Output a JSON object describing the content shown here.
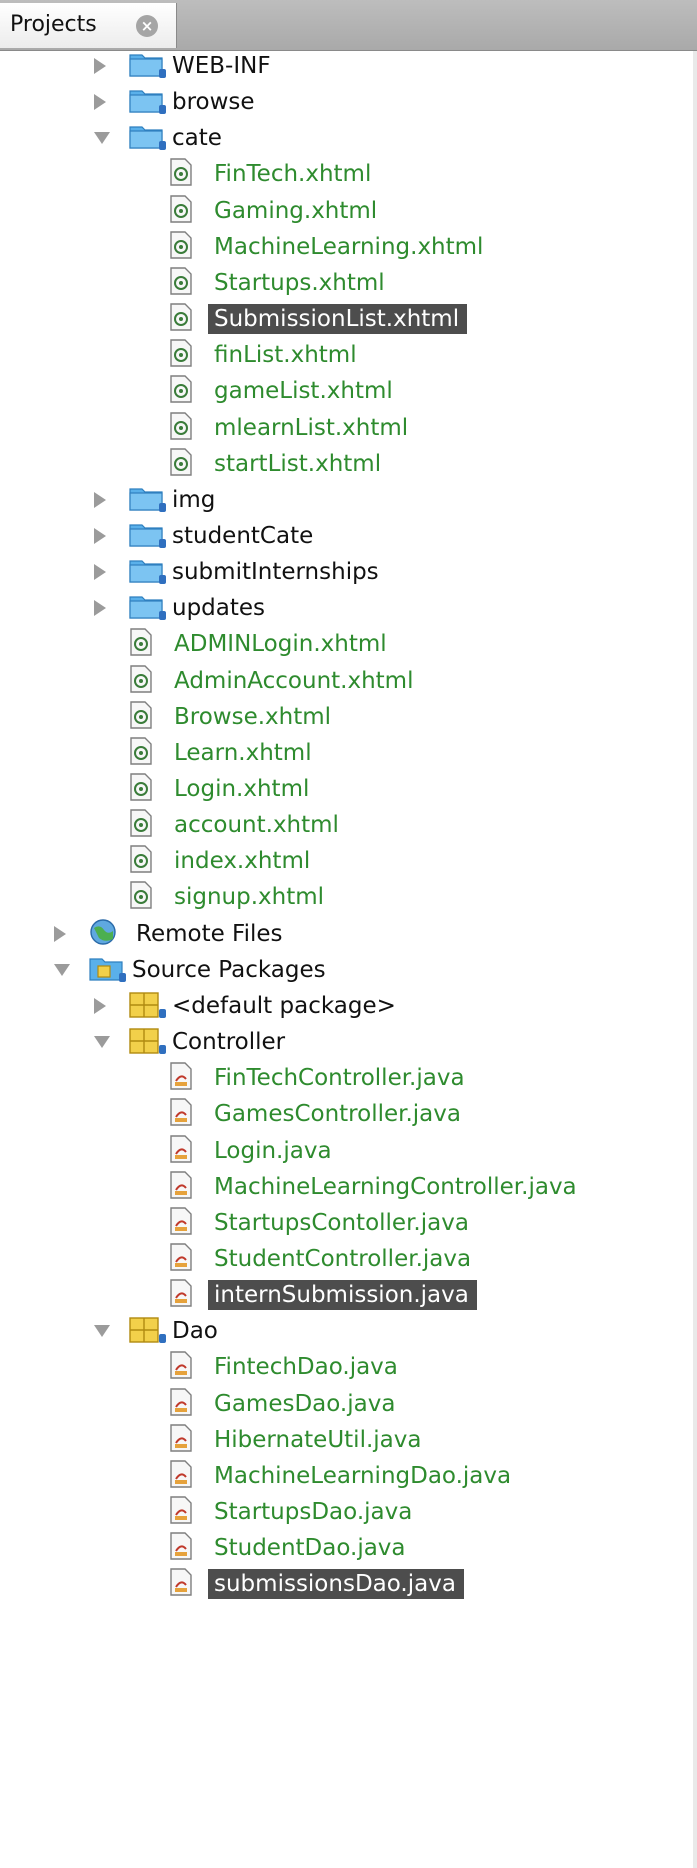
{
  "tab": {
    "label": "Projects"
  },
  "tree": [
    {
      "label": "WEB-INF",
      "kind": "folder",
      "depth": 2,
      "state": "collapsed",
      "style": "dark"
    },
    {
      "label": "browse",
      "kind": "folder",
      "depth": 2,
      "state": "collapsed",
      "style": "dark"
    },
    {
      "label": "cate",
      "kind": "folder",
      "depth": 2,
      "state": "expanded",
      "style": "dark"
    },
    {
      "label": "FinTech.xhtml",
      "kind": "xhtml",
      "depth": 3,
      "style": "green"
    },
    {
      "label": "Gaming.xhtml",
      "kind": "xhtml",
      "depth": 3,
      "style": "green"
    },
    {
      "label": "MachineLearning.xhtml",
      "kind": "xhtml",
      "depth": 3,
      "style": "green"
    },
    {
      "label": "Startups.xhtml",
      "kind": "xhtml",
      "depth": 3,
      "style": "green"
    },
    {
      "label": "SubmissionList.xhtml",
      "kind": "xhtml",
      "depth": 3,
      "style": "selected"
    },
    {
      "label": "finList.xhtml",
      "kind": "xhtml",
      "depth": 3,
      "style": "green"
    },
    {
      "label": "gameList.xhtml",
      "kind": "xhtml",
      "depth": 3,
      "style": "green"
    },
    {
      "label": "mlearnList.xhtml",
      "kind": "xhtml",
      "depth": 3,
      "style": "green"
    },
    {
      "label": "startList.xhtml",
      "kind": "xhtml",
      "depth": 3,
      "style": "green"
    },
    {
      "label": "img",
      "kind": "folder",
      "depth": 2,
      "state": "collapsed",
      "style": "dark"
    },
    {
      "label": "studentCate",
      "kind": "folder",
      "depth": 2,
      "state": "collapsed",
      "style": "dark"
    },
    {
      "label": "submitInternships",
      "kind": "folder",
      "depth": 2,
      "state": "collapsed",
      "style": "dark"
    },
    {
      "label": "updates",
      "kind": "folder",
      "depth": 2,
      "state": "collapsed",
      "style": "dark"
    },
    {
      "label": "ADMINLogin.xhtml",
      "kind": "xhtml",
      "depth": 2,
      "style": "green"
    },
    {
      "label": "AdminAccount.xhtml",
      "kind": "xhtml",
      "depth": 2,
      "style": "green"
    },
    {
      "label": "Browse.xhtml",
      "kind": "xhtml",
      "depth": 2,
      "style": "green"
    },
    {
      "label": "Learn.xhtml",
      "kind": "xhtml",
      "depth": 2,
      "style": "green"
    },
    {
      "label": "Login.xhtml",
      "kind": "xhtml",
      "depth": 2,
      "style": "green"
    },
    {
      "label": "account.xhtml",
      "kind": "xhtml",
      "depth": 2,
      "style": "green"
    },
    {
      "label": "index.xhtml",
      "kind": "xhtml",
      "depth": 2,
      "style": "green"
    },
    {
      "label": "signup.xhtml",
      "kind": "xhtml",
      "depth": 2,
      "style": "green"
    },
    {
      "label": "Remote Files",
      "kind": "globe",
      "depth": 1,
      "state": "collapsed",
      "style": "dark"
    },
    {
      "label": "Source Packages",
      "kind": "srcroot",
      "depth": 1,
      "state": "expanded",
      "style": "dark"
    },
    {
      "label": "<default package>",
      "kind": "package",
      "depth": 2,
      "state": "collapsed",
      "style": "dark"
    },
    {
      "label": "Controller",
      "kind": "package",
      "depth": 2,
      "state": "expanded",
      "style": "dark"
    },
    {
      "label": "FinTechController.java",
      "kind": "java",
      "depth": 3,
      "style": "green"
    },
    {
      "label": "GamesController.java",
      "kind": "java",
      "depth": 3,
      "style": "green"
    },
    {
      "label": "Login.java",
      "kind": "java",
      "depth": 3,
      "style": "green"
    },
    {
      "label": "MachineLearningController.java",
      "kind": "java",
      "depth": 3,
      "style": "green"
    },
    {
      "label": "StartupsContoller.java",
      "kind": "java",
      "depth": 3,
      "style": "green"
    },
    {
      "label": "StudentController.java",
      "kind": "java",
      "depth": 3,
      "style": "green"
    },
    {
      "label": "internSubmission.java",
      "kind": "java",
      "depth": 3,
      "style": "selected"
    },
    {
      "label": "Dao",
      "kind": "package",
      "depth": 2,
      "state": "expanded",
      "style": "dark"
    },
    {
      "label": "FintechDao.java",
      "kind": "java",
      "depth": 3,
      "style": "green"
    },
    {
      "label": "GamesDao.java",
      "kind": "java",
      "depth": 3,
      "style": "green"
    },
    {
      "label": "HibernateUtil.java",
      "kind": "java",
      "depth": 3,
      "style": "green"
    },
    {
      "label": "MachineLearningDao.java",
      "kind": "java",
      "depth": 3,
      "style": "green"
    },
    {
      "label": "StartupsDao.java",
      "kind": "java",
      "depth": 3,
      "style": "green"
    },
    {
      "label": "StudentDao.java",
      "kind": "java",
      "depth": 3,
      "style": "green"
    },
    {
      "label": "submissionsDao.java",
      "kind": "java",
      "depth": 3,
      "style": "selected"
    }
  ],
  "colors": {
    "modified_green": "#2e8b2e",
    "selection": "#4d4d4d",
    "folder_blue": "#5ab0ea",
    "package_yellow": "#f2d04a"
  }
}
